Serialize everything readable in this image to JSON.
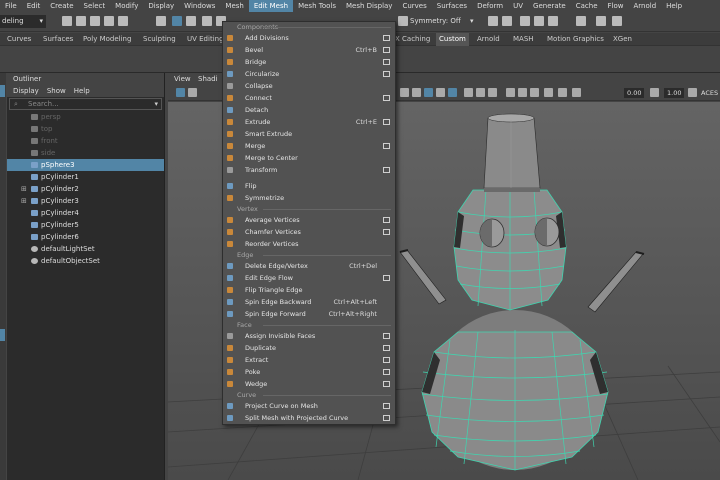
{
  "menubar": {
    "items": [
      "File",
      "Edit",
      "Create",
      "Select",
      "Modify",
      "Display",
      "Windows",
      "Mesh",
      "Edit Mesh",
      "Mesh Tools",
      "Mesh Display",
      "Curves",
      "Surfaces",
      "Deform",
      "UV",
      "Generate",
      "Cache",
      "Flow",
      "Arnold",
      "Help"
    ],
    "active": "Edit Mesh"
  },
  "status": {
    "mode": "deling",
    "symmetry": "Symmetry: Off"
  },
  "shelf": {
    "tabs": [
      "Curves",
      "Surfaces",
      "Poly Modeling",
      "Sculpting",
      "UV Editing",
      "X Caching",
      "Custom",
      "Arnold",
      "MASH",
      "Motion Graphics",
      "XGen"
    ],
    "active": "Custom"
  },
  "outliner": {
    "title": "Outliner",
    "menu": [
      "Display",
      "Show",
      "Help"
    ],
    "search_placeholder": "Search...",
    "items": [
      {
        "label": "persp",
        "type": "camera",
        "dim": true,
        "expand": ""
      },
      {
        "label": "top",
        "type": "camera",
        "dim": true,
        "expand": ""
      },
      {
        "label": "front",
        "type": "camera",
        "dim": true,
        "expand": ""
      },
      {
        "label": "side",
        "type": "camera",
        "dim": true,
        "expand": ""
      },
      {
        "label": "pSphere3",
        "type": "mesh",
        "selected": true,
        "expand": ""
      },
      {
        "label": "pCylinder1",
        "type": "mesh",
        "expand": ""
      },
      {
        "label": "pCylinder2",
        "type": "mesh",
        "expand": "⊞"
      },
      {
        "label": "pCylinder3",
        "type": "mesh",
        "expand": "⊞"
      },
      {
        "label": "pCylinder4",
        "type": "mesh",
        "expand": ""
      },
      {
        "label": "pCylinder5",
        "type": "mesh",
        "expand": ""
      },
      {
        "label": "pCylinder6",
        "type": "mesh",
        "expand": ""
      },
      {
        "label": "defaultLightSet",
        "type": "set",
        "expand": ""
      },
      {
        "label": "defaultObjectSet",
        "type": "set",
        "expand": ""
      }
    ]
  },
  "viewport": {
    "menu": [
      "View",
      "Shadi"
    ],
    "field1": "0.00",
    "field2": "1.00",
    "colorspace": "ACES"
  },
  "dropdown": {
    "rows": [
      {
        "kind": "section",
        "label": "Components"
      },
      {
        "kind": "item",
        "label": "Add Divisions",
        "shortcut": "",
        "box": true,
        "icon": "orange"
      },
      {
        "kind": "item",
        "label": "Bevel",
        "shortcut": "Ctrl+B",
        "box": true,
        "icon": "orange"
      },
      {
        "kind": "item",
        "label": "Bridge",
        "shortcut": "",
        "box": true,
        "icon": "orange"
      },
      {
        "kind": "item",
        "label": "Circularize",
        "shortcut": "",
        "box": true,
        "icon": "blue"
      },
      {
        "kind": "item",
        "label": "Collapse",
        "shortcut": "",
        "box": false,
        "icon": "gray"
      },
      {
        "kind": "item",
        "label": "Connect",
        "shortcut": "",
        "box": true,
        "icon": "orange"
      },
      {
        "kind": "item",
        "label": "Detach",
        "shortcut": "",
        "box": false,
        "icon": "blue"
      },
      {
        "kind": "item",
        "label": "Extrude",
        "shortcut": "Ctrl+E",
        "box": true,
        "icon": "orange"
      },
      {
        "kind": "item",
        "label": "Smart Extrude",
        "shortcut": "",
        "box": false,
        "icon": "orange"
      },
      {
        "kind": "item",
        "label": "Merge",
        "shortcut": "",
        "box": true,
        "icon": "orange"
      },
      {
        "kind": "item",
        "label": "Merge to Center",
        "shortcut": "",
        "box": false,
        "icon": "orange"
      },
      {
        "kind": "item",
        "label": "Transform",
        "shortcut": "",
        "box": true,
        "icon": "gray"
      },
      {
        "kind": "spacer"
      },
      {
        "kind": "item",
        "label": "Flip",
        "shortcut": "",
        "box": false,
        "icon": "blue"
      },
      {
        "kind": "item",
        "label": "Symmetrize",
        "shortcut": "",
        "box": false,
        "icon": "orange"
      },
      {
        "kind": "section",
        "label": "Vertex"
      },
      {
        "kind": "item",
        "label": "Average Vertices",
        "shortcut": "",
        "box": true,
        "icon": "orange"
      },
      {
        "kind": "item",
        "label": "Chamfer Vertices",
        "shortcut": "",
        "box": true,
        "icon": "orange"
      },
      {
        "kind": "item",
        "label": "Reorder Vertices",
        "shortcut": "",
        "box": false,
        "icon": "orange"
      },
      {
        "kind": "section",
        "label": "Edge"
      },
      {
        "kind": "item",
        "label": "Delete Edge/Vertex",
        "shortcut": "Ctrl+Del",
        "box": false,
        "icon": "blue"
      },
      {
        "kind": "item",
        "label": "Edit Edge Flow",
        "shortcut": "",
        "box": true,
        "icon": "blue"
      },
      {
        "kind": "item",
        "label": "Flip Triangle Edge",
        "shortcut": "",
        "box": false,
        "icon": "orange"
      },
      {
        "kind": "item",
        "label": "Spin Edge Backward",
        "shortcut": "Ctrl+Alt+Left",
        "box": false,
        "icon": "blue"
      },
      {
        "kind": "item",
        "label": "Spin Edge Forward",
        "shortcut": "Ctrl+Alt+Right",
        "box": false,
        "icon": "blue"
      },
      {
        "kind": "section",
        "label": "Face"
      },
      {
        "kind": "item",
        "label": "Assign Invisible Faces",
        "shortcut": "",
        "box": true,
        "icon": "gray"
      },
      {
        "kind": "item",
        "label": "Duplicate",
        "shortcut": "",
        "box": true,
        "icon": "orange"
      },
      {
        "kind": "item",
        "label": "Extract",
        "shortcut": "",
        "box": true,
        "icon": "orange"
      },
      {
        "kind": "item",
        "label": "Poke",
        "shortcut": "",
        "box": true,
        "icon": "orange"
      },
      {
        "kind": "item",
        "label": "Wedge",
        "shortcut": "",
        "box": true,
        "icon": "orange"
      },
      {
        "kind": "section",
        "label": "Curve"
      },
      {
        "kind": "item",
        "label": "Project Curve on Mesh",
        "shortcut": "",
        "box": true,
        "icon": "blue"
      },
      {
        "kind": "item",
        "label": "Split Mesh with Projected Curve",
        "shortcut": "",
        "box": true,
        "icon": "blue"
      }
    ]
  }
}
